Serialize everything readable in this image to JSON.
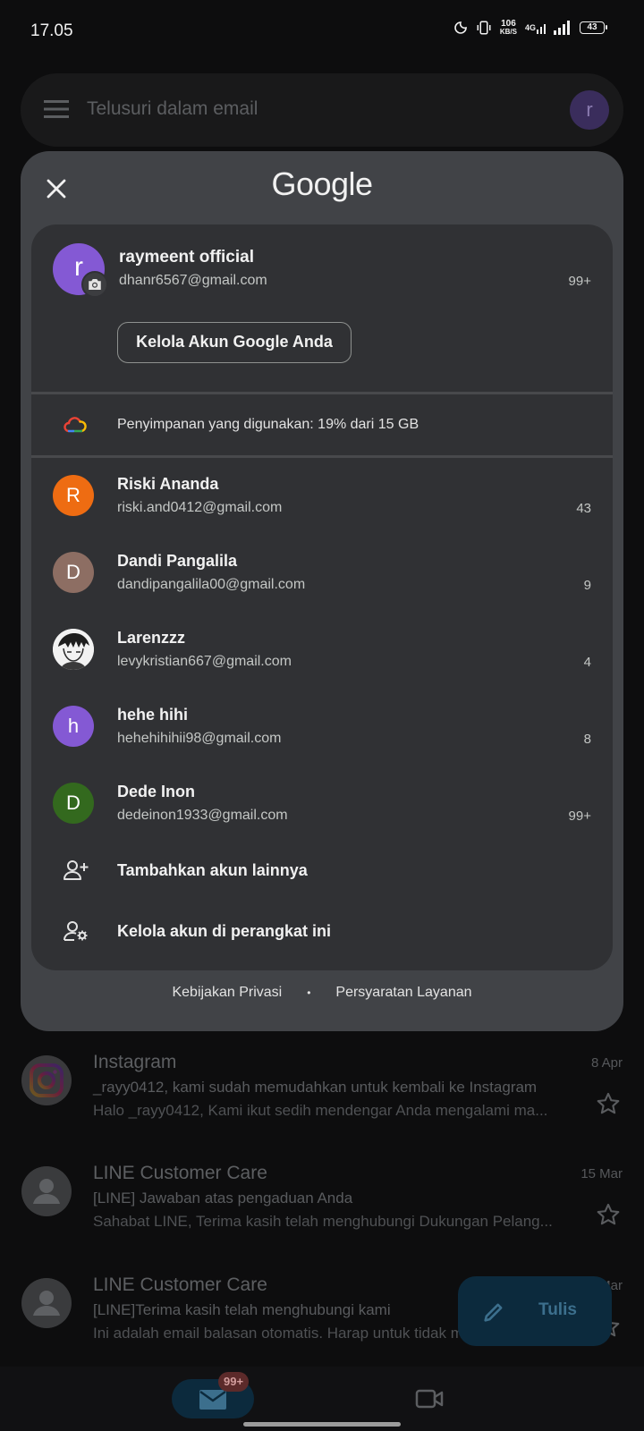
{
  "status_bar": {
    "time": "17.05",
    "net_speed_value": "106",
    "net_speed_unit": "KB/S",
    "network_type": "4G",
    "battery": "43"
  },
  "background": {
    "search_placeholder": "Telusuri dalam email",
    "avatar_letter": "r",
    "emails": [
      {
        "sender": "Instagram",
        "date": "8 Apr",
        "subject": "_rayy0412, kami sudah memudahkan untuk kembali ke Instagram",
        "snippet": "Halo _rayy0412, Kami ikut sedih mendengar Anda mengalami ma..."
      },
      {
        "sender": "LINE Customer Care",
        "date": "15 Mar",
        "subject": "[LINE] Jawaban atas pengaduan Anda",
        "snippet": "Sahabat LINE, Terima kasih telah menghubungi Dukungan Pelang..."
      },
      {
        "sender": "LINE Customer Care",
        "date": "Mar",
        "subject": "[LINE]Terima kasih telah menghubungi kami",
        "snippet": "Ini adalah email balasan otomatis. Harap untuk tidak membalas e..."
      }
    ],
    "compose_label": "Tulis",
    "mail_badge": "99+"
  },
  "switcher": {
    "logo": "Google",
    "primary": {
      "avatar_letter": "r",
      "name": "raymeent official",
      "email": "dhanr6567@gmail.com",
      "unread": "99+",
      "manage_label": "Kelola Akun Google Anda",
      "avatar_color": "#8459d4"
    },
    "storage_text": "Penyimpanan yang digunakan: 19% dari 15 GB",
    "accounts": [
      {
        "letter": "R",
        "name": "Riski Ananda",
        "email": "riski.and0412@gmail.com",
        "unread": "43",
        "color": "#ee6c12"
      },
      {
        "letter": "D",
        "name": "Dandi Pangalila",
        "email": "dandipangalila00@gmail.com",
        "unread": "9",
        "color": "#8d6e63"
      },
      {
        "letter": "",
        "name": "Larenzzz",
        "email": "levykristian667@gmail.com",
        "unread": "4",
        "color": "#e6e6e6"
      },
      {
        "letter": "h",
        "name": "hehe hihi",
        "email": "hehehihihii98@gmail.com",
        "unread": "8",
        "color": "#8459d4"
      },
      {
        "letter": "D",
        "name": "Dede Inon",
        "email": "dedeinon1933@gmail.com",
        "unread": "99+",
        "color": "#33691e"
      }
    ],
    "add_account_label": "Tambahkan akun lainnya",
    "manage_device_label": "Kelola akun di perangkat ini",
    "privacy_label": "Kebijakan Privasi",
    "separator": "•",
    "terms_label": "Persyaratan Layanan"
  }
}
